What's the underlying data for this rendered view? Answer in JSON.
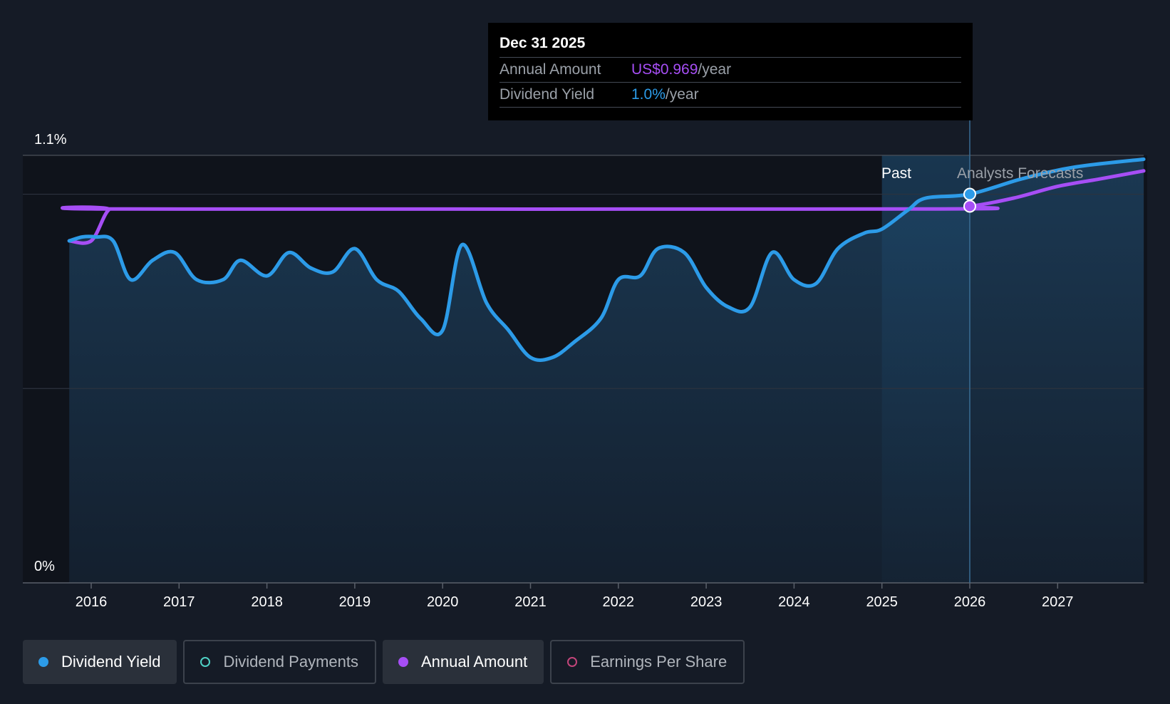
{
  "chart_data": {
    "type": "line",
    "y_axis": {
      "min": 0,
      "max": 1.1,
      "top_label": "1.1%",
      "bottom_label": "0%"
    },
    "x_axis": {
      "tick_labels": [
        "2016",
        "2017",
        "2018",
        "2019",
        "2020",
        "2021",
        "2022",
        "2023",
        "2024",
        "2025",
        "2026",
        "2027"
      ],
      "start": 2015.75,
      "end": 2027.98
    },
    "regions": {
      "past_label": "Past",
      "forecast_label": "Analysts Forecasts",
      "divider_x": 2026.0
    },
    "series": [
      {
        "name": "Dividend Yield",
        "color": "#2c9be8",
        "points": [
          [
            2015.75,
            0.88
          ],
          [
            2015.9,
            0.89
          ],
          [
            2016.05,
            0.89
          ],
          [
            2016.25,
            0.88
          ],
          [
            2016.45,
            0.78
          ],
          [
            2016.7,
            0.83
          ],
          [
            2016.95,
            0.85
          ],
          [
            2017.2,
            0.78
          ],
          [
            2017.5,
            0.78
          ],
          [
            2017.7,
            0.83
          ],
          [
            2018.0,
            0.79
          ],
          [
            2018.25,
            0.85
          ],
          [
            2018.5,
            0.81
          ],
          [
            2018.75,
            0.8
          ],
          [
            2019.0,
            0.86
          ],
          [
            2019.25,
            0.78
          ],
          [
            2019.5,
            0.75
          ],
          [
            2019.75,
            0.68
          ],
          [
            2020.0,
            0.65
          ],
          [
            2020.22,
            0.87
          ],
          [
            2020.5,
            0.72
          ],
          [
            2020.75,
            0.65
          ],
          [
            2021.0,
            0.58
          ],
          [
            2021.25,
            0.58
          ],
          [
            2021.5,
            0.62
          ],
          [
            2021.8,
            0.68
          ],
          [
            2022.0,
            0.78
          ],
          [
            2022.25,
            0.79
          ],
          [
            2022.45,
            0.86
          ],
          [
            2022.75,
            0.85
          ],
          [
            2023.0,
            0.76
          ],
          [
            2023.25,
            0.71
          ],
          [
            2023.5,
            0.71
          ],
          [
            2023.75,
            0.85
          ],
          [
            2024.0,
            0.78
          ],
          [
            2024.25,
            0.77
          ],
          [
            2024.5,
            0.86
          ],
          [
            2024.8,
            0.9
          ],
          [
            2025.0,
            0.91
          ],
          [
            2025.3,
            0.96
          ],
          [
            2025.5,
            0.99
          ],
          [
            2026.0,
            1.0
          ],
          [
            2026.6,
            1.04
          ],
          [
            2027.2,
            1.07
          ],
          [
            2027.98,
            1.09
          ]
        ]
      },
      {
        "name": "Annual Amount",
        "color": "#a64ef5",
        "points": [
          [
            2015.75,
            0.88
          ],
          [
            2016.0,
            0.88
          ],
          [
            2016.2,
            0.96
          ],
          [
            2016.4,
            0.962
          ],
          [
            2025.5,
            0.962
          ],
          [
            2026.0,
            0.969
          ],
          [
            2026.5,
            0.99
          ],
          [
            2027.0,
            1.02
          ],
          [
            2027.5,
            1.04
          ],
          [
            2027.98,
            1.06
          ]
        ]
      }
    ],
    "highlight_x": 2026.0
  },
  "tooltip": {
    "date": "Dec 31 2025",
    "rows": [
      {
        "label": "Annual Amount",
        "value": "US$0.969",
        "suffix": "/year"
      },
      {
        "label": "Dividend Yield",
        "value": "1.0%",
        "suffix": "/year"
      }
    ]
  },
  "legend": [
    {
      "label": "Dividend Yield",
      "active": true,
      "color": "#2c9be8"
    },
    {
      "label": "Dividend Payments",
      "active": false,
      "color": "#4fd1c5"
    },
    {
      "label": "Annual Amount",
      "active": true,
      "color": "#a64ef5"
    },
    {
      "label": "Earnings Per Share",
      "active": false,
      "color": "#c2457a"
    }
  ]
}
